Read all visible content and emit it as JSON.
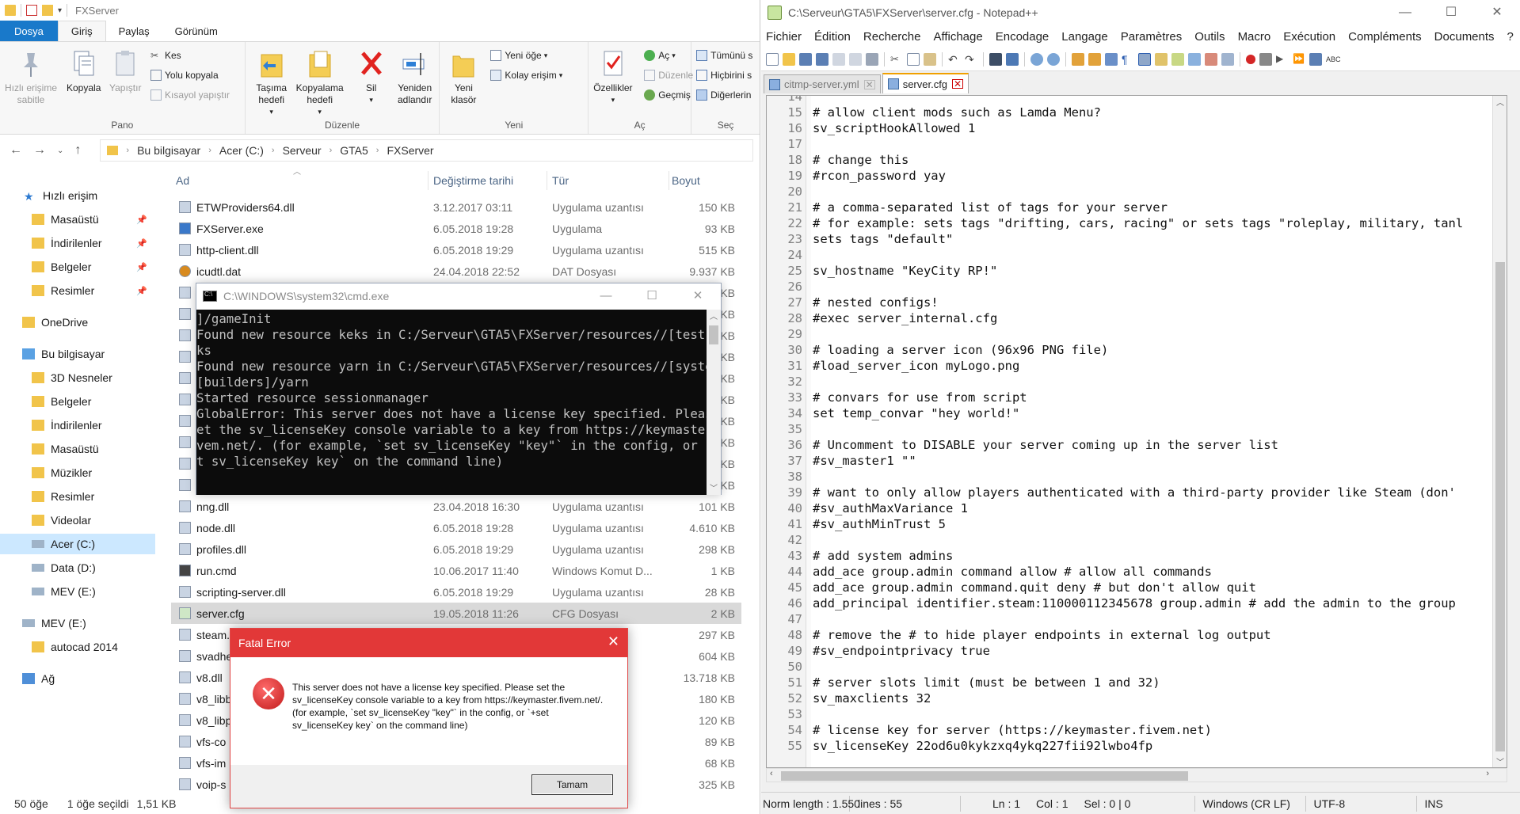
{
  "explorer": {
    "title": "FXServer",
    "tabs": [
      "Dosya",
      "Giriş",
      "Paylaş",
      "Görünüm"
    ],
    "ribbon": {
      "pin": "Hızlı erişime sabitle",
      "copy": "Kopyala",
      "paste": "Yapıştır",
      "cut": "Kes",
      "copy_path": "Yolu kopyala",
      "paste_shortcut": "Kısayol yapıştır",
      "group_clipboard": "Pano",
      "move_to": "Taşıma hedefi",
      "copy_to": "Kopyalama hedefi",
      "delete": "Sil",
      "rename": "Yeniden adlandır",
      "group_organize": "Düzenle",
      "new_folder": "Yeni klasör",
      "new_item": "Yeni öğe",
      "easy_access": "Kolay erişim",
      "group_new": "Yeni",
      "properties": "Özellikler",
      "open": "Aç",
      "edit": "Düzenle",
      "history": "Geçmiş",
      "group_open": "Aç",
      "select_all": "Tümünü s",
      "select_none": "Hiçbirini s",
      "invert": "Diğerlerin",
      "group_select": "Seç"
    },
    "breadcrumb": [
      "Bu bilgisayar",
      "Acer (C:)",
      "Serveur",
      "GTA5",
      "FXServer"
    ],
    "nav": {
      "quick_access": "Hızlı erişim",
      "qa_items": [
        "Masaüstü",
        "İndirilenler",
        "Belgeler",
        "Resimler"
      ],
      "onedrive": "OneDrive",
      "this_pc": "Bu bilgisayar",
      "pc_items": [
        "3D Nesneler",
        "Belgeler",
        "İndirilenler",
        "Masaüstü",
        "Müzikler",
        "Resimler",
        "Videolar",
        "Acer (C:)",
        "Data (D:)",
        "MEV (E:)"
      ],
      "mev": "MEV (E:)",
      "autocad": "autocad 2014",
      "network": "Ağ"
    },
    "columns": [
      "Ad",
      "Değiştirme tarihi",
      "Tür",
      "Boyut"
    ],
    "files": [
      {
        "name": "ETWProviders64.dll",
        "date": "3.12.2017 03:11",
        "type": "Uygulama uzantısı",
        "size": "150 KB",
        "icon": "dll-icon"
      },
      {
        "name": "FXServer.exe",
        "date": "6.05.2018 19:28",
        "type": "Uygulama",
        "size": "93 KB",
        "icon": "exe-icon"
      },
      {
        "name": "http-client.dll",
        "date": "6.05.2018 19:29",
        "type": "Uygulama uzantısı",
        "size": "515 KB",
        "icon": "dll-icon"
      },
      {
        "name": "icudtl.dat",
        "date": "24.04.2018 22:52",
        "type": "DAT Dosyası",
        "size": "9.937 KB",
        "icon": "dat-icon"
      },
      {
        "name": "",
        "date": "",
        "type": "",
        "size": "KB",
        "icon": "dll-icon"
      },
      {
        "name": "",
        "date": "",
        "type": "",
        "size": "KB",
        "icon": "dll-icon"
      },
      {
        "name": "",
        "date": "",
        "type": "",
        "size": "KB",
        "icon": "dll-icon"
      },
      {
        "name": "",
        "date": "",
        "type": "",
        "size": "KB",
        "icon": "dll-icon"
      },
      {
        "name": "",
        "date": "",
        "type": "",
        "size": "KB",
        "icon": "dll-icon"
      },
      {
        "name": "",
        "date": "",
        "type": "",
        "size": "KB",
        "icon": "dll-icon"
      },
      {
        "name": "",
        "date": "",
        "type": "",
        "size": "KB",
        "icon": "dll-icon"
      },
      {
        "name": "",
        "date": "",
        "type": "",
        "size": "KB",
        "icon": "dll-icon"
      },
      {
        "name": "",
        "date": "",
        "type": "",
        "size": "KB",
        "icon": "dll-icon"
      },
      {
        "name": "",
        "date": "",
        "type": "",
        "size": "KB",
        "icon": "dll-icon"
      },
      {
        "name": "nng.dll",
        "date": "23.04.2018 16:30",
        "type": "Uygulama uzantısı",
        "size": "101 KB",
        "icon": "dll-icon"
      },
      {
        "name": "node.dll",
        "date": "6.05.2018 19:28",
        "type": "Uygulama uzantısı",
        "size": "4.610 KB",
        "icon": "dll-icon"
      },
      {
        "name": "profiles.dll",
        "date": "6.05.2018 19:29",
        "type": "Uygulama uzantısı",
        "size": "298 KB",
        "icon": "dll-icon"
      },
      {
        "name": "run.cmd",
        "date": "10.06.2017 11:40",
        "type": "Windows Komut D...",
        "size": "1 KB",
        "icon": "cmd-icon"
      },
      {
        "name": "scripting-server.dll",
        "date": "6.05.2018 19:29",
        "type": "Uygulama uzantısı",
        "size": "28 KB",
        "icon": "dll-icon"
      },
      {
        "name": "server.cfg",
        "date": "19.05.2018 11:26",
        "type": "CFG Dosyası",
        "size": "2 KB",
        "icon": "cfg-icon"
      },
      {
        "name": "steam.",
        "date": "",
        "type": "",
        "size": "297 KB",
        "icon": "dll-icon"
      },
      {
        "name": "svadhe",
        "date": "",
        "type": "ntısı",
        "size": "604 KB",
        "icon": "dll-icon"
      },
      {
        "name": "v8.dll",
        "date": "",
        "type": "ntısı",
        "size": "13.718 KB",
        "icon": "dll-icon"
      },
      {
        "name": "v8_libb",
        "date": "",
        "type": "ntısı",
        "size": "180 KB",
        "icon": "dll-icon"
      },
      {
        "name": "v8_libp",
        "date": "",
        "type": "ntısı",
        "size": "120 KB",
        "icon": "dll-icon"
      },
      {
        "name": "vfs-co",
        "date": "",
        "type": "ntısı",
        "size": "89 KB",
        "icon": "dll-icon"
      },
      {
        "name": "vfs-im",
        "date": "",
        "type": "ntısı",
        "size": "68 KB",
        "icon": "dll-icon"
      },
      {
        "name": "voip-s",
        "date": "",
        "type": "ntısı",
        "size": "325 KB",
        "icon": "dll-icon"
      }
    ],
    "status": {
      "count": "50 öğe",
      "selected": "1 öğe seçildi",
      "size": "1,51 KB"
    }
  },
  "cmd": {
    "title": "C:\\WINDOWS\\system32\\cmd.exe",
    "lines": [
      "]/gameInit",
      "Found new resource keks in C:/Serveur\\GTA5\\FXServer/resources//[test]/ke",
      "ks",
      "Found new resource yarn in C:/Serveur\\GTA5\\FXServer/resources//[system]/",
      "[builders]/yarn",
      "Started resource sessionmanager",
      "GlobalError: This server does not have a license key specified. Please s",
      "et the sv_licenseKey console variable to a key from https://keymaster.fi",
      "vem.net/. (for example, `set sv_licenseKey \"key\"` in the config, or `+se",
      "t sv_licenseKey key` on the command line)"
    ]
  },
  "fatal": {
    "title": "Fatal Error",
    "message": "This server does not have a license key specified. Please set the sv_licenseKey console variable to a key from https://keymaster.fivem.net/. (for example, `set sv_licenseKey \"key\"` in the config, or `+set sv_licenseKey key` on the command line)",
    "ok": "Tamam"
  },
  "npp": {
    "title": "C:\\Serveur\\GTA5\\FXServer\\server.cfg - Notepad++",
    "menu": [
      "Fichier",
      "Édition",
      "Recherche",
      "Affichage",
      "Encodage",
      "Langage",
      "Paramètres",
      "Outils",
      "Macro",
      "Exécution",
      "Compléments",
      "Documents",
      "?",
      "X"
    ],
    "tabs": [
      {
        "label": "citmp-server.yml",
        "active": false
      },
      {
        "label": "server.cfg",
        "active": true
      }
    ],
    "lines": [
      {
        "n": "14",
        "t": ""
      },
      {
        "n": "15",
        "t": "# allow client mods such as Lamda Menu?"
      },
      {
        "n": "16",
        "t": "sv_scriptHookAllowed 1"
      },
      {
        "n": "17",
        "t": ""
      },
      {
        "n": "18",
        "t": "# change this"
      },
      {
        "n": "19",
        "t": "#rcon_password yay"
      },
      {
        "n": "20",
        "t": ""
      },
      {
        "n": "21",
        "t": "# a comma-separated list of tags for your server"
      },
      {
        "n": "22",
        "t": "# for example: sets tags \"drifting, cars, racing\" or sets tags \"roleplay, military, tanl"
      },
      {
        "n": "23",
        "t": "sets tags \"default\""
      },
      {
        "n": "24",
        "t": ""
      },
      {
        "n": "25",
        "t": "sv_hostname \"KeyCity RP!\""
      },
      {
        "n": "26",
        "t": ""
      },
      {
        "n": "27",
        "t": "# nested configs!"
      },
      {
        "n": "28",
        "t": "#exec server_internal.cfg"
      },
      {
        "n": "29",
        "t": ""
      },
      {
        "n": "30",
        "t": "# loading a server icon (96x96 PNG file)"
      },
      {
        "n": "31",
        "t": "#load_server_icon myLogo.png"
      },
      {
        "n": "32",
        "t": ""
      },
      {
        "n": "33",
        "t": "# convars for use from script"
      },
      {
        "n": "34",
        "t": "set temp_convar \"hey world!\""
      },
      {
        "n": "35",
        "t": ""
      },
      {
        "n": "36",
        "t": "# Uncomment to DISABLE your server coming up in the server list"
      },
      {
        "n": "37",
        "t": "#sv_master1 \"\""
      },
      {
        "n": "38",
        "t": ""
      },
      {
        "n": "39",
        "t": "# want to only allow players authenticated with a third-party provider like Steam (don'"
      },
      {
        "n": "40",
        "t": "#sv_authMaxVariance 1"
      },
      {
        "n": "41",
        "t": "#sv_authMinTrust 5"
      },
      {
        "n": "42",
        "t": ""
      },
      {
        "n": "43",
        "t": "# add system admins"
      },
      {
        "n": "44",
        "t": "add_ace group.admin command allow # allow all commands"
      },
      {
        "n": "45",
        "t": "add_ace group.admin command.quit deny # but don't allow quit"
      },
      {
        "n": "46",
        "t": "add_principal identifier.steam:110000112345678 group.admin # add the admin to the group"
      },
      {
        "n": "47",
        "t": ""
      },
      {
        "n": "48",
        "t": "# remove the # to hide player endpoints in external log output"
      },
      {
        "n": "49",
        "t": "#sv_endpointprivacy true"
      },
      {
        "n": "50",
        "t": ""
      },
      {
        "n": "51",
        "t": "# server slots limit (must be between 1 and 32)"
      },
      {
        "n": "52",
        "t": "sv_maxclients 32"
      },
      {
        "n": "53",
        "t": ""
      },
      {
        "n": "54",
        "t": "# license key for server (https://keymaster.fivem.net)"
      },
      {
        "n": "55",
        "t": "sv_licenseKey 22od6u0kykzxq4ykq227fii92lwbo4fp"
      }
    ],
    "status": {
      "length": "Norm length : 1.550",
      "lines": "lines : 55",
      "ln": "Ln : 1",
      "col": "Col : 1",
      "sel": "Sel : 0 | 0",
      "eol": "Windows (CR LF)",
      "enc": "UTF-8",
      "mode": "INS"
    }
  },
  "colors": {
    "accent": "#1979ca",
    "error": "#e23838",
    "selected_nav": "#cce8ff"
  }
}
